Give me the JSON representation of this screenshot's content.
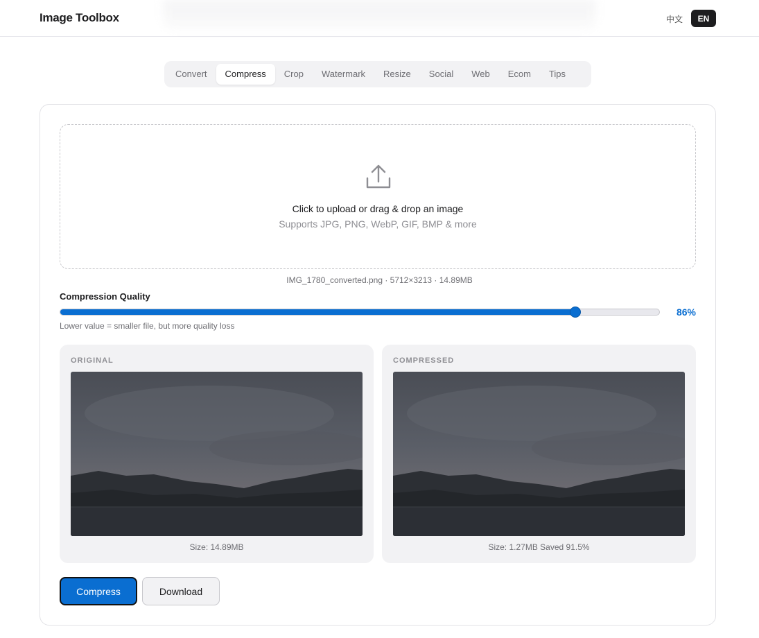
{
  "header": {
    "brand": "Image Toolbox",
    "lang_zh": "中文",
    "lang_en": "EN"
  },
  "tabs": [
    {
      "label": "Convert",
      "active": false
    },
    {
      "label": "Compress",
      "active": true
    },
    {
      "label": "Crop",
      "active": false
    },
    {
      "label": "Watermark",
      "active": false
    },
    {
      "label": "Resize",
      "active": false
    },
    {
      "label": "Social",
      "active": false
    },
    {
      "label": "Web",
      "active": false
    },
    {
      "label": "Ecom",
      "active": false
    },
    {
      "label": "Tips",
      "active": false
    }
  ],
  "upload": {
    "icon": "upload-icon",
    "title": "Click to upload or drag & drop an image",
    "subtitle": "Supports JPG, PNG, WebP, GIF, BMP & more"
  },
  "file_info": "IMG_1780_converted.png · 5712×3213 · 14.89MB",
  "quality": {
    "label": "Compression Quality",
    "value": 86,
    "value_text": "86%",
    "help": "Lower value = smaller file, but more quality loss"
  },
  "original": {
    "label": "ORIGINAL",
    "size_text": "Size: 14.89MB"
  },
  "compressed": {
    "label": "COMPRESSED",
    "size_text": "Size: 1.27MB Saved 91.5%"
  },
  "actions": {
    "compress": "Compress",
    "download": "Download"
  },
  "colors": {
    "accent": "#0a6ed1",
    "dark": "#1d1d1f",
    "panel_bg": "#f2f2f4"
  }
}
